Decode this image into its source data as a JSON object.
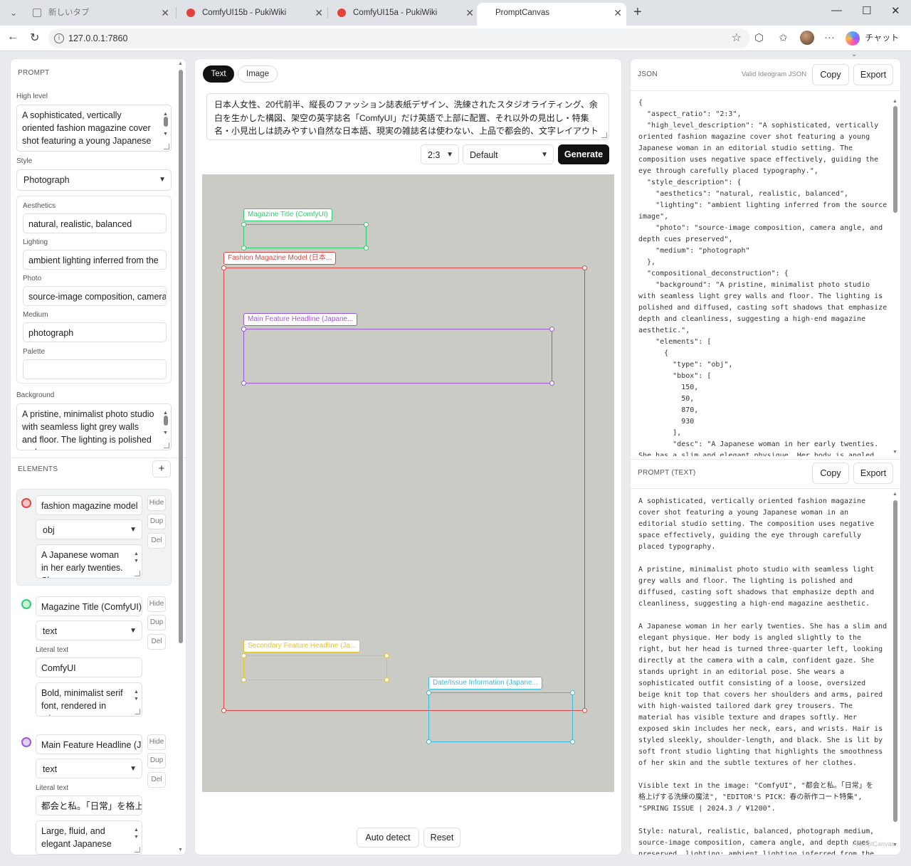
{
  "browser": {
    "tabs": [
      {
        "title": "新しいタブ",
        "favicon": "newtab-icon"
      },
      {
        "title": "ComfyUI15b - PukiWiki",
        "favicon": "pukiwiki-icon"
      },
      {
        "title": "ComfyUI15a - PukiWiki",
        "favicon": "pukiwiki-icon"
      },
      {
        "title": "PromptCanvas",
        "favicon": ""
      }
    ],
    "url": "127.0.0.1:7860",
    "copilot_label": "チャット"
  },
  "prompt_panel": {
    "title": "PROMPT",
    "high_level_label": "High level",
    "high_level_text": "A sophisticated, vertically oriented fashion magazine cover shot featuring a young Japanese",
    "style_label": "Style",
    "style_value": "Photograph",
    "aesthetics_label": "Aesthetics",
    "aesthetics_value": "natural, realistic, balanced",
    "lighting_label": "Lighting",
    "lighting_value": "ambient lighting inferred from the",
    "photo_label": "Photo",
    "photo_value": "source-image composition, camera",
    "medium_label": "Medium",
    "medium_value": "photograph",
    "palette_label": "Palette",
    "palette_value": "",
    "background_label": "Background",
    "background_text": "A pristine, minimalist photo studio with seamless light grey walls and floor. The lighting is polished and"
  },
  "elements_panel": {
    "title": "ELEMENTS",
    "add_label": "+",
    "hide_label": "Hide",
    "dup_label": "Dup",
    "del_label": "Del",
    "literal_label": "Literal text",
    "items": [
      {
        "name": "fashion magazine model",
        "type": "obj",
        "desc": "A Japanese woman in her early twenties. She",
        "color": "#e04646"
      },
      {
        "name": "Magazine Title (ComfyUI)",
        "type": "text",
        "literal": "ComfyUI",
        "desc": "Bold, minimalist serif font, rendered in crisp",
        "color": "#2ecc71"
      },
      {
        "name": "Main Feature Headline (Japanese)",
        "type": "text",
        "literal": "都会と私。「日常」を格上げ",
        "desc": "Large, fluid, and elegant Japanese",
        "color": "#9b59d6"
      }
    ]
  },
  "editor": {
    "tab_text": "Text",
    "tab_image": "Image",
    "input_text": "日本人女性、20代前半、縦長のファッション誌表紙デザイン、洗練されたスタジオライティング、余白を生かした構図、架空の英字誌名「ComfyUI」だけ英語で上部に配置、それ以外の見出し・特集名・小見出しは読みやすい自然な日本語、現実の雑誌名は使わない、上品で都会的、文字レイアウトまで完成度の高いビジュアル",
    "aspect_value": "2:3",
    "preset_value": "Default",
    "generate_label": "Generate",
    "auto_detect_label": "Auto detect",
    "reset_label": "Reset"
  },
  "canvas_boxes": [
    {
      "label": "Magazine Title (ComfyUI)",
      "color": "#2ecc71"
    },
    {
      "label": "Fashion Magazine Model (日本...",
      "color": "#e04646"
    },
    {
      "label": "Main Feature Headline (Japane...",
      "color": "#9b59d6"
    },
    {
      "label": "Secondary Feature Headline (Ja...",
      "color": "#e6c229"
    },
    {
      "label": "Date/Issue Information (Japane...",
      "color": "#3bbbd8"
    }
  ],
  "json_panel": {
    "title": "JSON",
    "status": "Valid Ideogram JSON",
    "copy_label": "Copy",
    "export_label": "Export",
    "content": "{\n  \"aspect_ratio\": \"2:3\",\n  \"high_level_description\": \"A sophisticated, vertically\noriented fashion magazine cover shot featuring a young\nJapanese woman in an editorial studio setting. The\ncomposition uses negative space effectively, guiding the\neye through carefully placed typography.\",\n  \"style_description\": {\n    \"aesthetics\": \"natural, realistic, balanced\",\n    \"lighting\": \"ambient lighting inferred from the source\nimage\",\n    \"photo\": \"source-image composition, camera angle, and\ndepth cues preserved\",\n    \"medium\": \"photograph\"\n  },\n  \"compositional_deconstruction\": {\n    \"background\": \"A pristine, minimalist photo studio\nwith seamless light grey walls and floor. The lighting is\npolished and diffused, casting soft shadows that emphasize\ndepth and cleanliness, suggesting a high-end magazine\naesthetic.\",\n    \"elements\": [\n      {\n        \"type\": \"obj\",\n        \"bbox\": [\n          150,\n          50,\n          870,\n          930\n        ],\n        \"desc\": \"A Japanese woman in her early twenties.\nShe has a slim and elegant physique. Her body is angled"
  },
  "prompt_text_panel": {
    "title": "PROMPT (TEXT)",
    "copy_label": "Copy",
    "export_label": "Export",
    "content": "A sophisticated, vertically oriented fashion magazine\ncover shot featuring a young Japanese woman in an\neditorial studio setting. The composition uses negative\nspace effectively, guiding the eye through carefully\nplaced typography.\n\nA pristine, minimalist photo studio with seamless light\ngrey walls and floor. The lighting is polished and\ndiffused, casting soft shadows that emphasize depth and\ncleanliness, suggesting a high-end magazine aesthetic.\n\nA Japanese woman in her early twenties. She has a slim and\nelegant physique. Her body is angled slightly to the\nright, but her head is turned three-quarter left, looking\ndirectly at the camera with a calm, confident gaze. She\nstands upright in an editorial pose. She wears a\nsophisticated outfit consisting of a loose, oversized\nbeige knit top that covers her shoulders and arms, paired\nwith high-waisted tailored dark grey trousers. The\nmaterial has visible texture and drapes softly. Her\nexposed skin includes her neck, ears, and wrists. Hair is\nstyled sleekly, shoulder-length, and black. She is lit by\nsoft front studio lighting that highlights the smoothness\nof her skin and the subtle textures of her clothes.\n\nVisible text in the image: \"ComfyUI\", \"都会と私。「日常」を\n格上げする洗練の魔法\", \"EDITOR'S PICK：春の新作コート特集\",\n\"SPRING ISSUE | 2024.3 / ¥1200\".\n\nStyle: natural, realistic, balanced, photograph medium,\nsource-image composition, camera angle, and depth cues\npreserved, lighting: ambient lighting inferred from the",
    "watermark": "PromptCanvas"
  }
}
